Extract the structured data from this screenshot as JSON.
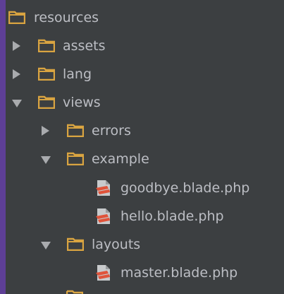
{
  "tree": {
    "resources": {
      "label": "resources",
      "icon": "folder-icon",
      "expanded": true
    },
    "assets": {
      "label": "assets",
      "icon": "folder-icon",
      "expanded": false
    },
    "lang": {
      "label": "lang",
      "icon": "folder-icon",
      "expanded": false
    },
    "views": {
      "label": "views",
      "icon": "folder-icon",
      "expanded": true
    },
    "errors": {
      "label": "errors",
      "icon": "folder-icon",
      "expanded": false
    },
    "example": {
      "label": "example",
      "icon": "folder-icon",
      "expanded": true
    },
    "goodbye": {
      "label": "goodbye.blade.php",
      "icon": "blade-file-icon"
    },
    "hello": {
      "label": "hello.blade.php",
      "icon": "blade-file-icon"
    },
    "layouts": {
      "label": "layouts",
      "icon": "folder-icon",
      "expanded": true
    },
    "master": {
      "label": "master.blade.php",
      "icon": "blade-file-icon"
    }
  },
  "colors": {
    "background": "#3c3f41",
    "outer": "#5e3f96",
    "text": "#bcbec4",
    "folder": "#d9a441",
    "blade": "#e0533a",
    "arrow": "#a9abae"
  }
}
